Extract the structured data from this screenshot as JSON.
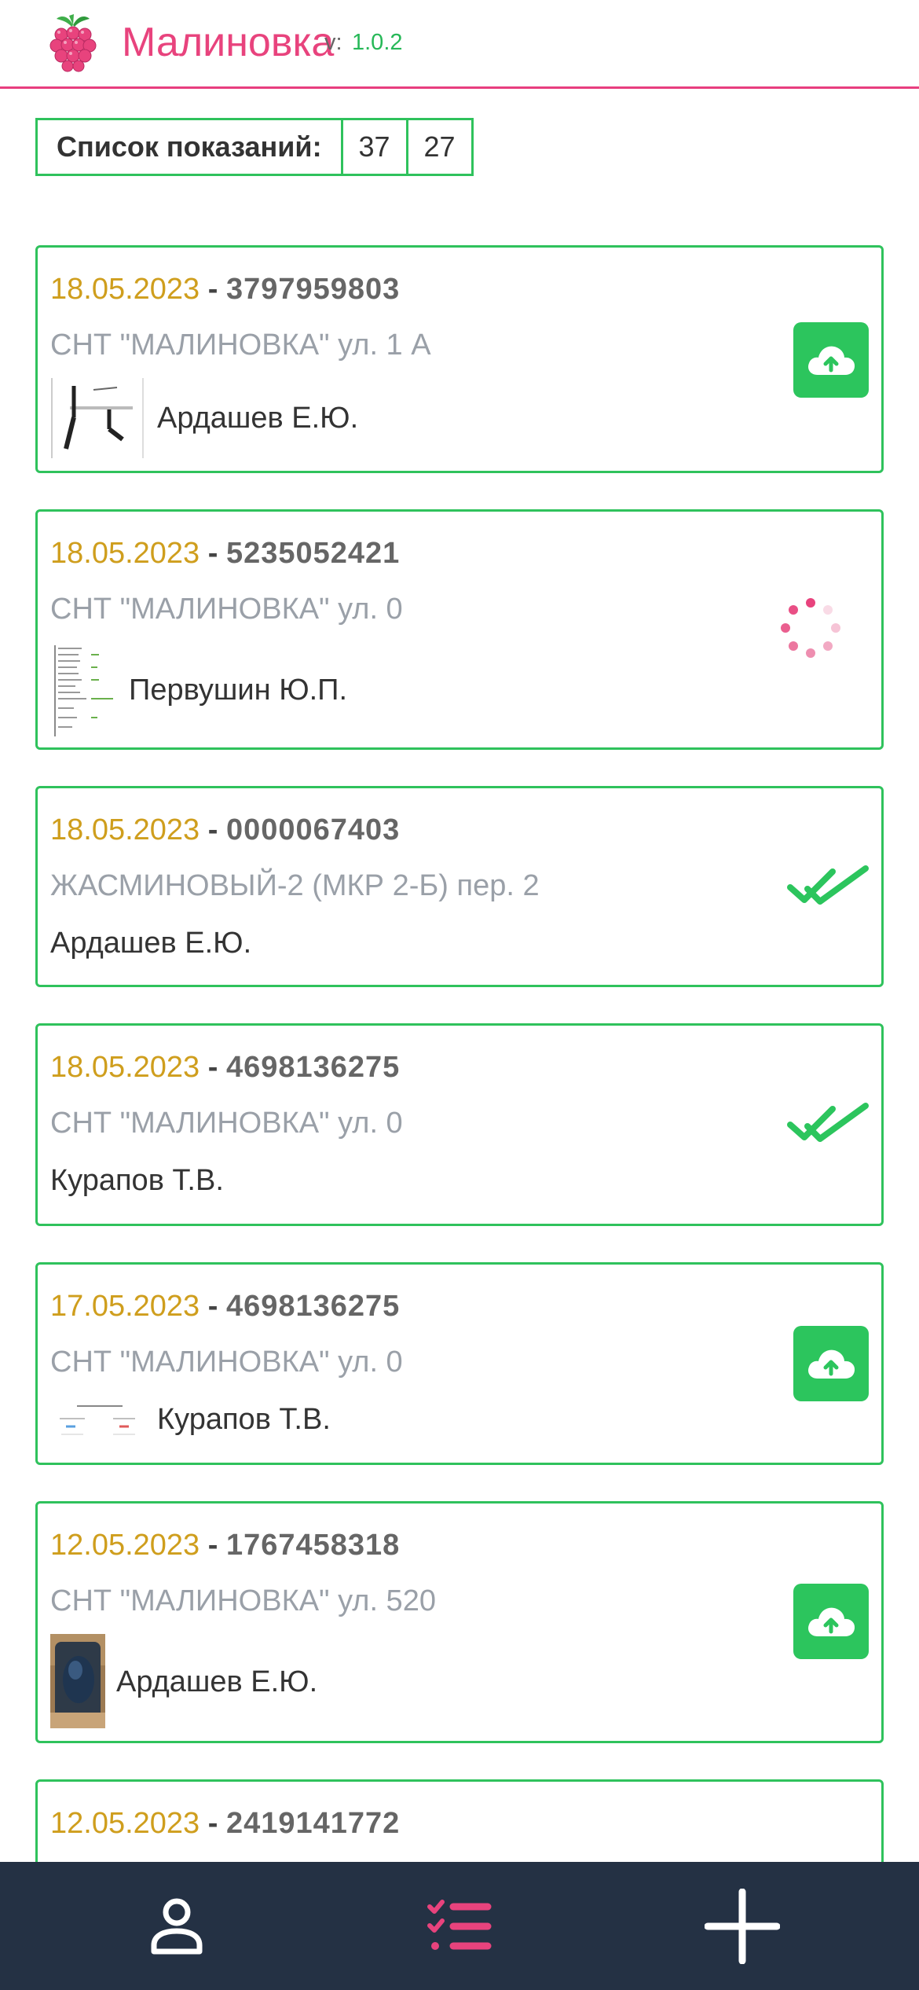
{
  "header": {
    "title": "Малиновка",
    "version_label": "v:",
    "version": "1.0.2",
    "logo_icon": "raspberry-icon",
    "accent_color": "#e8437d"
  },
  "counter": {
    "label": "Список показаний:",
    "value_1": "37",
    "value_2": "27"
  },
  "cards": [
    {
      "date": "18.05.2023",
      "separator": "-",
      "account": "3797959803",
      "address": "СНТ \"МАЛИНОВКА\" ул. 1 А",
      "owner": "Ардашев Е.Ю.",
      "status": "upload"
    },
    {
      "date": "18.05.2023",
      "separator": "-",
      "account": "5235052421",
      "address": "СНТ \"МАЛИНОВКА\" ул. 0",
      "owner": "Первушин Ю.П.",
      "status": "loading"
    },
    {
      "date": "18.05.2023",
      "separator": "-",
      "account": "0000067403",
      "address": "ЖАСМИНОВЫЙ-2 (МКР 2-Б) пер. 2",
      "owner": "Ардашев Е.Ю.",
      "status": "sent"
    },
    {
      "date": "18.05.2023",
      "separator": "-",
      "account": "4698136275",
      "address": "СНТ \"МАЛИНОВКА\" ул. 0",
      "owner": "Курапов Т.В.",
      "status": "sent"
    },
    {
      "date": "17.05.2023",
      "separator": "-",
      "account": "4698136275",
      "address": "СНТ \"МАЛИНОВКА\" ул. 0",
      "owner": "Курапов Т.В.",
      "status": "upload"
    },
    {
      "date": "12.05.2023",
      "separator": "-",
      "account": "1767458318",
      "address": "СНТ \"МАЛИНОВКА\" ул. 520",
      "owner": "Ардашев Е.Ю.",
      "status": "upload"
    },
    {
      "date": "12.05.2023",
      "separator": "-",
      "account": "2419141772"
    }
  ],
  "bottom_nav": {
    "items": [
      {
        "icon": "user-icon"
      },
      {
        "icon": "checklist-icon",
        "active": true
      },
      {
        "icon": "plus-icon"
      }
    ],
    "active_color": "#e8437d"
  }
}
